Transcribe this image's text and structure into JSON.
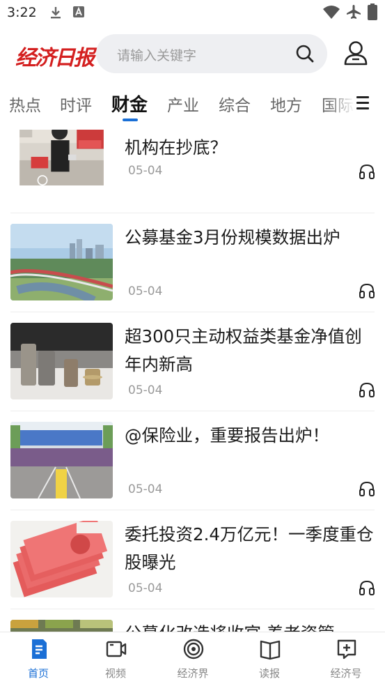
{
  "status_bar": {
    "time": "3:22",
    "icons": [
      "download-icon",
      "a-notification-icon",
      "wifi-icon",
      "airplane-icon",
      "battery-icon"
    ]
  },
  "header": {
    "logo_text": "经济日报",
    "search_placeholder": "请输入关键字",
    "search_icon": "search-icon",
    "user_icon": "user-icon"
  },
  "tabs": {
    "items": [
      "热点",
      "时评",
      "财金",
      "产业",
      "综合",
      "地方",
      "国际"
    ],
    "active": "财金",
    "menu_icon": "menu-icon"
  },
  "news": [
    {
      "title": "消费潮助推这类基金大涨！哪些机构在抄底？",
      "date": "05-04",
      "thumb": "store-photo"
    },
    {
      "title": "公募基金3月份规模数据出炉",
      "date": "05-04",
      "thumb": "city-rail-photo"
    },
    {
      "title": "超300只主动权益类基金净值创年内新高",
      "date": "05-04",
      "thumb": "coins-photo"
    },
    {
      "title": "@保险业，重要报告出炉！",
      "date": "05-04",
      "thumb": "marathon-photo"
    },
    {
      "title": "委托投资2.4万亿元！一季度重仓股曝光",
      "date": "05-04",
      "thumb": "banknotes-photo"
    },
    {
      "title": "公募化改造将收官 养老资管",
      "date": "",
      "thumb": "partial-photo"
    }
  ],
  "bottom_nav": [
    {
      "label": "首页",
      "icon": "home-doc-icon",
      "active": true
    },
    {
      "label": "视频",
      "icon": "video-icon",
      "active": false
    },
    {
      "label": "经济界",
      "icon": "target-icon",
      "active": false
    },
    {
      "label": "读报",
      "icon": "book-icon",
      "active": false
    },
    {
      "label": "经济号",
      "icon": "plus-square-icon",
      "active": false
    }
  ],
  "colors": {
    "accent": "#1a6fd6",
    "logo": "#d42020",
    "search_bg": "#eeeff2"
  }
}
